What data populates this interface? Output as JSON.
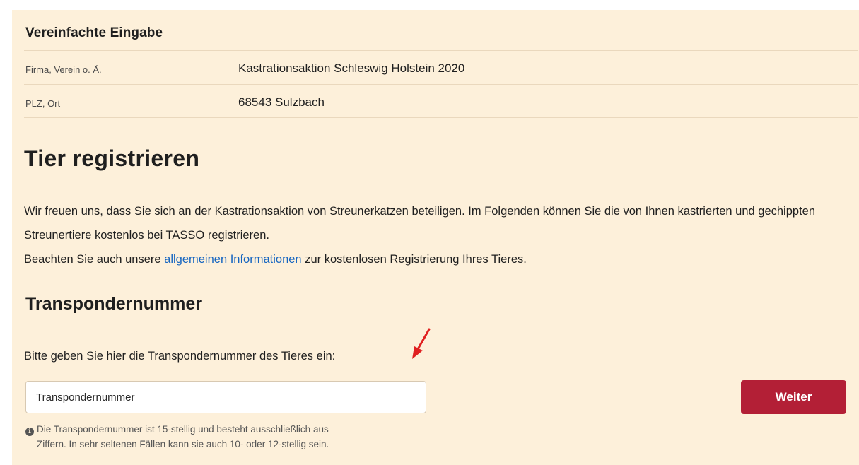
{
  "simple_entry": {
    "title": "Vereinfachte Eingabe",
    "rows": [
      {
        "label": "Firma, Verein o. Ä.",
        "value": "Kastrationsaktion Schleswig Holstein 2020"
      },
      {
        "label": "PLZ, Ort",
        "value": "68543 Sulzbach"
      }
    ]
  },
  "main": {
    "heading": "Tier registrieren",
    "intro_line1": "Wir freuen uns, dass Sie sich an der Kastrationsaktion von Streunerkatzen beteiligen. Im Folgenden können Sie die von Ihnen kastrierten und gechippten Streunertiere kostenlos bei TASSO registrieren.",
    "intro_line2_before": "Beachten Sie auch unsere ",
    "intro_link": "allgemeinen Informationen",
    "intro_line2_after": " zur kostenlosen Registrierung Ihres Tieres."
  },
  "transponder": {
    "heading": "Transpondernummer",
    "prompt": "Bitte geben Sie hier die Transpondernummer des Tieres ein:",
    "input_placeholder": "Transpondernummer",
    "input_value": "",
    "button_label": "Weiter",
    "hint_icon": "info-circle-icon",
    "hint_line1": "Die Transpondernummer ist 15-stellig und besteht ausschließlich aus",
    "hint_line2": "Ziffern. In sehr seltenen Fällen kann sie auch 10- oder 12-stellig sein."
  },
  "colors": {
    "panel_bg": "#fdf0da",
    "accent_button": "#b31f36",
    "link": "#1565c0",
    "annotation_arrow": "#e02020"
  }
}
